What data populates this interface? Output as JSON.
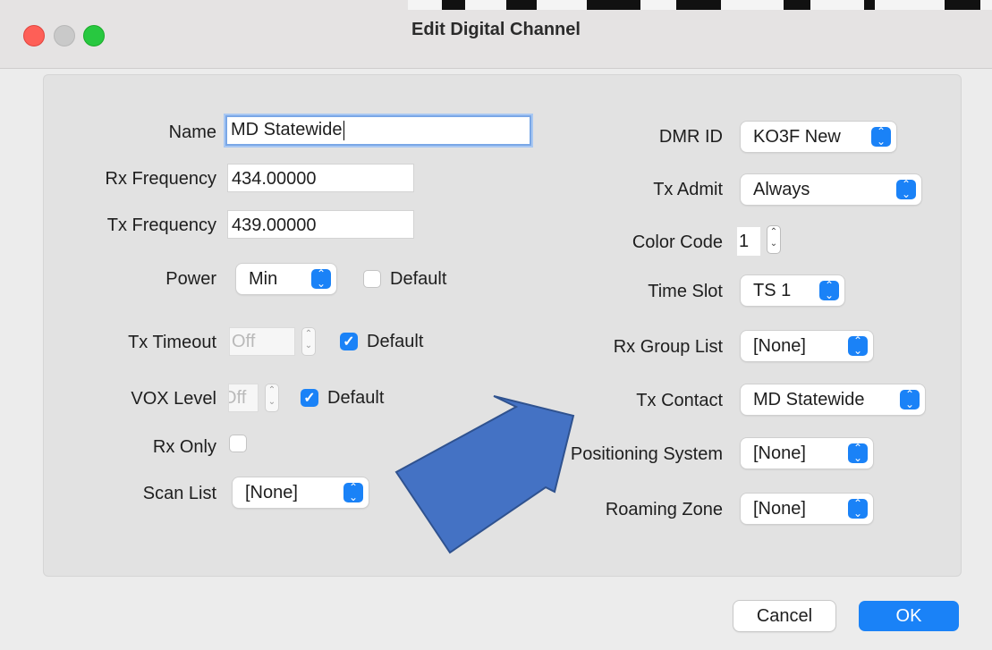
{
  "window": {
    "title": "Edit Digital Channel"
  },
  "left": {
    "name": {
      "label": "Name",
      "value": "MD Statewide"
    },
    "rx_frequency": {
      "label": "Rx Frequency",
      "value": "434.00000"
    },
    "tx_frequency": {
      "label": "Tx Frequency",
      "value": "439.00000"
    },
    "power": {
      "label": "Power",
      "value": "Min",
      "default_label": "Default",
      "default_checked": false
    },
    "tx_timeout": {
      "label": "Tx Timeout",
      "value": "Off",
      "default_label": "Default",
      "default_checked": true
    },
    "vox_level": {
      "label": "VOX Level",
      "value": "Off",
      "default_label": "Default",
      "default_checked": true
    },
    "rx_only": {
      "label": "Rx Only",
      "checked": false
    },
    "scan_list": {
      "label": "Scan List",
      "value": "[None]"
    }
  },
  "right": {
    "dmr_id": {
      "label": "DMR ID",
      "value": "KO3F New"
    },
    "tx_admit": {
      "label": "Tx Admit",
      "value": "Always"
    },
    "color_code": {
      "label": "Color Code",
      "value": "1"
    },
    "time_slot": {
      "label": "Time Slot",
      "value": "TS 1"
    },
    "rx_group_list": {
      "label": "Rx Group List",
      "value": "[None]"
    },
    "tx_contact": {
      "label": "Tx Contact",
      "value": "MD Statewide"
    },
    "positioning_system": {
      "label": "Positioning System",
      "value": "[None]"
    },
    "roaming_zone": {
      "label": "Roaming Zone",
      "value": "[None]"
    }
  },
  "buttons": {
    "cancel": "Cancel",
    "ok": "OK"
  },
  "colors": {
    "accent": "#1a82f7",
    "arrow_fill": "#4472c4",
    "arrow_stroke": "#2f528f"
  },
  "icons": {
    "popup": "chevron-updown-icon",
    "check": "checkmark-icon",
    "stepper": "stepper-arrows-icon",
    "annotation": "arrow-annotation"
  }
}
